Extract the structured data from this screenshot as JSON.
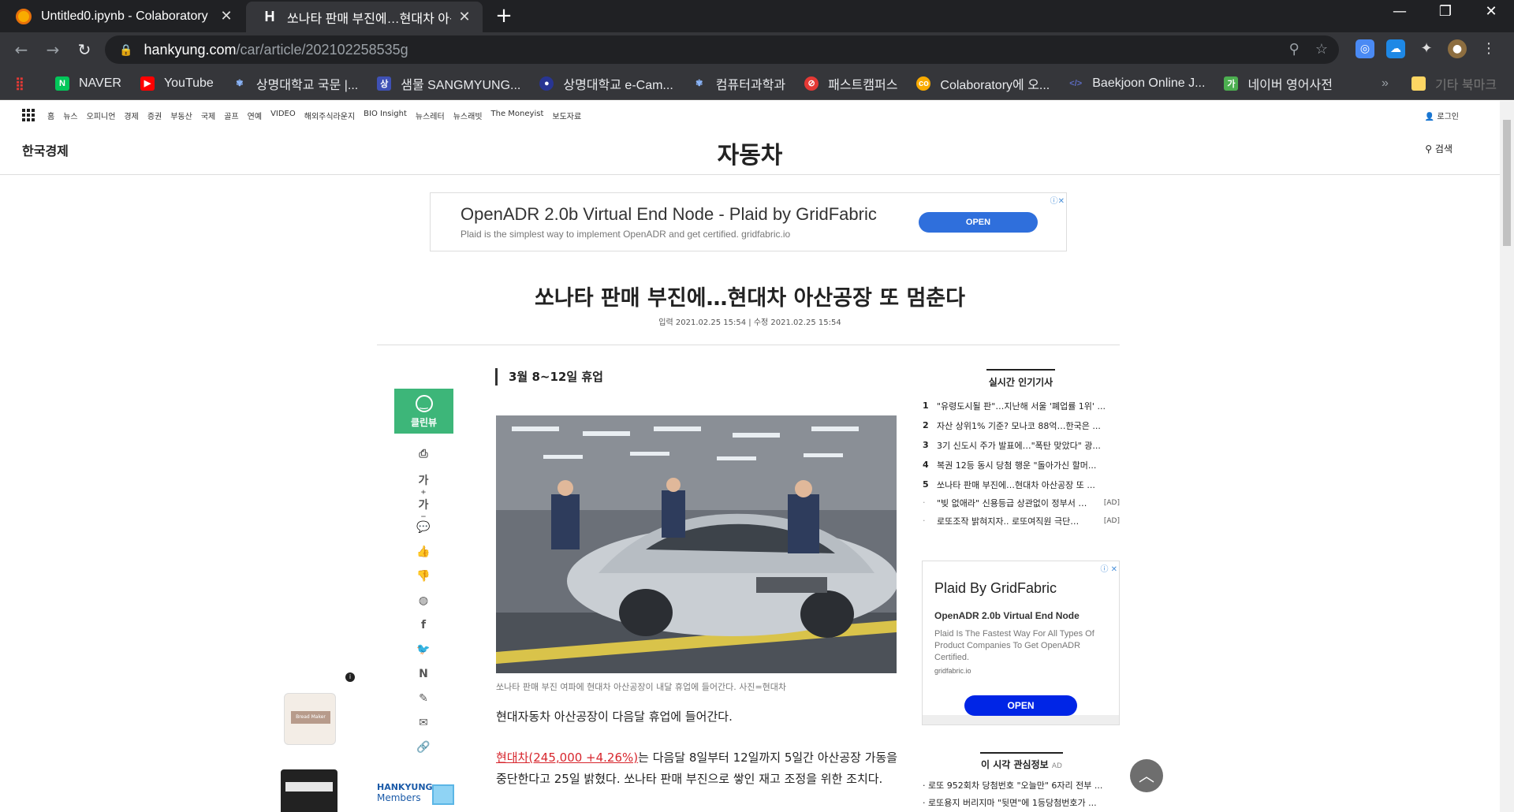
{
  "browser": {
    "tabs": [
      {
        "title": "Untitled0.ipynb - Colaboratory",
        "close": "✕"
      },
      {
        "title": "쏘나타 판매 부진에…현대차 아산공",
        "close": "✕"
      }
    ],
    "new_tab": "+",
    "window": {
      "minimize": "—",
      "maximize": "❐",
      "close": "✕"
    },
    "url": {
      "host": "hankyung.com",
      "path": "/car/article/202102258535g"
    },
    "bookmarks": [
      {
        "label": "",
        "icon": "apps-icon",
        "color": "#e53935"
      },
      {
        "label": "NAVER",
        "icon": "naver-icon",
        "color": "#03c75a"
      },
      {
        "label": "YouTube",
        "icon": "youtube-icon",
        "color": "#ff0000"
      },
      {
        "label": "상명대학교 국문 |...",
        "icon": "smu-icon",
        "color": "#8ab4f8"
      },
      {
        "label": "샘물 SANGMYUNG...",
        "icon": "smu-icon",
        "color": "#3f51b5"
      },
      {
        "label": "상명대학교 e-Cam...",
        "icon": "globe-icon",
        "color": "#3949ab"
      },
      {
        "label": "컴퓨터과학과",
        "icon": "smu-icon",
        "color": "#8ab4f8"
      },
      {
        "label": "패스트캠퍼스",
        "icon": "fastcampus-icon",
        "color": "#e53935"
      },
      {
        "label": "Colaboratory에 오...",
        "icon": "colab-icon",
        "color": "#f9ab00"
      },
      {
        "label": "Baekjoon Online J...",
        "icon": "code-icon",
        "color": "#5c6bc0"
      },
      {
        "label": "네이버 영어사전",
        "icon": "dict-icon",
        "color": "#4caf50"
      }
    ],
    "more_bookmarks": "»",
    "other_bookmarks": "기타 북마크"
  },
  "site": {
    "gnb": [
      "홈",
      "뉴스",
      "오피니언",
      "경제",
      "증권",
      "부동산",
      "국제",
      "골프",
      "연예",
      "VIDEO",
      "해외주식라운지",
      "BIO Insight",
      "뉴스레터",
      "뉴스래빗",
      "The Moneyist",
      "보도자료"
    ],
    "login": "로그인",
    "logo": "한국경제",
    "section": "자동차",
    "search": "검색"
  },
  "ad_top": {
    "headline": "OpenADR 2.0b Virtual End Node - Plaid by GridFabric",
    "sub": "Plaid is the simplest way to implement OpenADR and get certified. gridfabric.io",
    "button": "OPEN"
  },
  "article": {
    "title": "쏘나타 판매 부진에…현대차 아산공장 또 멈춘다",
    "dates": "입력 2021.02.25 15:54 | 수정 2021.02.25 15:54",
    "subhead": "3월 8~12일 휴업",
    "caption": "쏘나타 판매 부진 여파에 현대차 아산공장이 내달 휴업에 들어간다. 사진=현대차",
    "p1": "현대자동차 아산공장이 다음달 휴업에 들어간다.",
    "p2_stock": "현대차(245,000 +4.26%)",
    "p2_rest": "는 다음달 8일부터 12일까지 5일간 아산공장 가동을 중단한다고 25일 밝혔다. 쏘나타 판매 부진으로 쌓인 재고 조정을 위한 조치다."
  },
  "tools": {
    "cleanview": "클린뷰",
    "icons": [
      "print-icon",
      "font-larger-icon",
      "font-smaller-icon",
      "comment-icon",
      "like-icon",
      "dislike-icon",
      "kakaotalk-icon",
      "facebook-icon",
      "twitter-icon",
      "naver-share-icon",
      "link-clip-icon",
      "email-icon",
      "url-link-icon"
    ]
  },
  "popular": {
    "title": "실시간 인기기사",
    "items": [
      {
        "n": "1",
        "t": "\"유령도시될 판\"…지난해 서울 '폐업률 1위' ..."
      },
      {
        "n": "2",
        "t": "자산 상위1% 기준? 모나코 88억…한국은 ..."
      },
      {
        "n": "3",
        "t": "3기 신도시 주가 발표에…\"폭탄 맞았다\" 광..."
      },
      {
        "n": "4",
        "t": "복권 12등 동시 당첨 행운 \"돌아가신 할머..."
      },
      {
        "n": "5",
        "t": "쏘나타 판매 부진에…현대차 아산공장 또 ..."
      }
    ],
    "ads": [
      {
        "n": "·",
        "t": "\"빚 없애라\" 신용등급 상관없이 정부서 …",
        "tag": "[AD]"
      },
      {
        "n": "·",
        "t": "로또조작 밝혀지자.. 로또여직원 극단…",
        "tag": "[AD]"
      }
    ]
  },
  "ad_side": {
    "headline": "Plaid By GridFabric",
    "title": "OpenADR 2.0b Virtual End Node",
    "desc": "Plaid Is The Fastest Way For All Types Of Product Companies To Get OpenADR Certified.",
    "domain": "gridfabric.io",
    "button": "OPEN"
  },
  "interest": {
    "title": "이 시각 관심정보",
    "ad": "AD",
    "items": [
      "· 로또 952회차 당첨번호 \"오늘만\" 6자리 전부 ...",
      "· 로또용지 버리지마 \"뒷면\"에 1등당첨번호가 ..."
    ]
  },
  "members": {
    "line1": "HANKYUNG",
    "line2": "Members"
  },
  "left_ad": {
    "label": "Bread Maker"
  },
  "to_top": "︿"
}
